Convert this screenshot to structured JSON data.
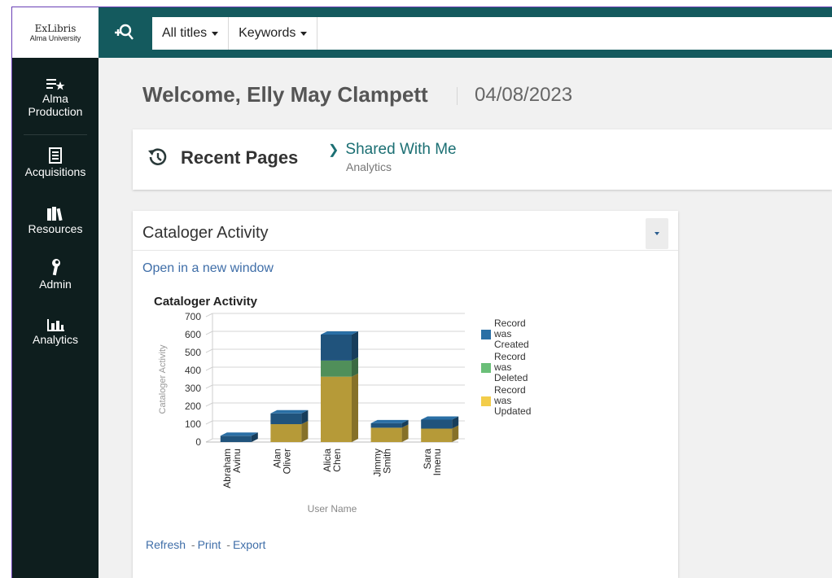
{
  "logo": {
    "line1": "ExLibris",
    "line2": "Alma University"
  },
  "search": {
    "scope": "All titles",
    "field": "Keywords"
  },
  "sidebar": {
    "items": [
      {
        "label_line1": "Alma",
        "label_line2": "Production",
        "icon": "star-list-icon"
      },
      {
        "label": "Acquisitions",
        "icon": "ledger-icon"
      },
      {
        "label": "Resources",
        "icon": "books-icon"
      },
      {
        "label": "Admin",
        "icon": "wrench-icon"
      },
      {
        "label": "Analytics",
        "icon": "bar-chart-icon"
      }
    ]
  },
  "welcome": {
    "text": "Welcome, Elly May Clampett",
    "date": "04/08/2023"
  },
  "recent": {
    "title": "Recent Pages",
    "shared_label": "Shared With Me",
    "shared_sub": "Analytics"
  },
  "panel": {
    "title": "Cataloger Activity",
    "open_link": "Open in a new window",
    "refresh": "Refresh",
    "print": "Print",
    "export": "Export",
    "sep": "-"
  },
  "chart_data": {
    "type": "bar",
    "stacked": true,
    "title": "Cataloger Activity",
    "xlabel": "User Name",
    "ylabel": "Cataloger Activity",
    "ylim": [
      0,
      700
    ],
    "yticks": [
      0,
      100,
      200,
      300,
      400,
      500,
      600,
      700
    ],
    "categories": [
      "Abraham Avinu",
      "Alan Oliver",
      "Alicia Chen",
      "Jimmy Smith",
      "Sara Imenu"
    ],
    "category_lines": [
      [
        "Abraham",
        "Avinu"
      ],
      [
        "Alan",
        "Oliver"
      ],
      [
        "Alicia",
        "Chen"
      ],
      [
        "Jimmy",
        "Smith"
      ],
      [
        "Sara",
        "Imenu"
      ]
    ],
    "series": [
      {
        "name": "Record was Updated",
        "name_lines": [
          "Record",
          "was",
          "Updated"
        ],
        "color": "#f3cd4a",
        "values": [
          0,
          100,
          365,
          80,
          75
        ]
      },
      {
        "name": "Record was Deleted",
        "name_lines": [
          "Record",
          "was",
          "Deleted"
        ],
        "color": "#6abf78",
        "values": [
          0,
          0,
          90,
          0,
          0
        ]
      },
      {
        "name": "Record was Created",
        "name_lines": [
          "Record",
          "was",
          "Created"
        ],
        "color": "#2a6fa5",
        "values": [
          35,
          60,
          145,
          25,
          50
        ]
      }
    ],
    "legend_order": [
      2,
      1,
      0
    ],
    "legend": "right",
    "grid": true
  }
}
